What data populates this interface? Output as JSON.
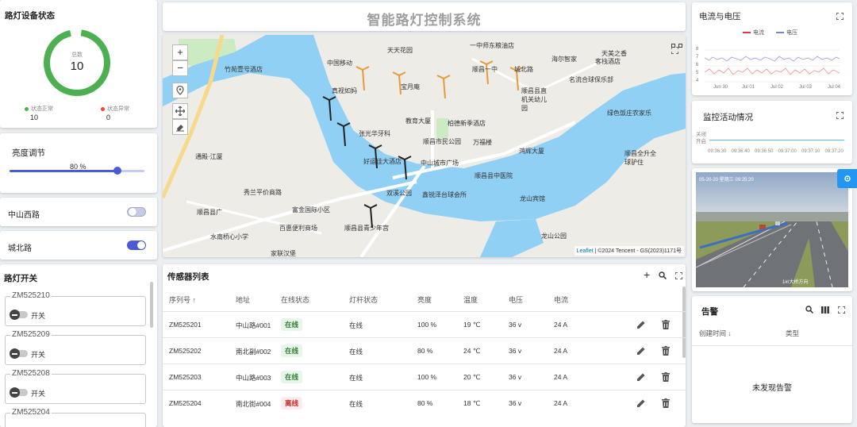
{
  "status": {
    "title": "路灯设备状态",
    "total_label": "总数",
    "total_value": "10",
    "normal_label": "状态正常",
    "normal_value": "10",
    "abnormal_label": "状态异常",
    "abnormal_value": "0",
    "normal_color": "#4caf50",
    "abnormal_color": "#f44336"
  },
  "brightness": {
    "title": "亮度调节",
    "value_label": "80 %",
    "value": 0.8
  },
  "roads": [
    {
      "name": "中山西路",
      "on": false
    },
    {
      "name": "城北路",
      "on": true
    }
  ],
  "switches": {
    "title": "路灯开关",
    "items": [
      {
        "id": "ZM525210",
        "label": "开关"
      },
      {
        "id": "ZM525209",
        "label": "开关"
      },
      {
        "id": "ZM525208",
        "label": "开关"
      },
      {
        "id": "ZM525204",
        "label": ""
      }
    ]
  },
  "header": {
    "title": "智能路灯控制系统"
  },
  "map": {
    "attribution_leaflet": "Leaflet",
    "attribution_rest": " | ©2024 Tencent - GS(2023)1171号",
    "labels": [
      "天天花园",
      "一中师东粮油店",
      "中国移动",
      "天美之香",
      "竹苑壹号酒店",
      "海尔智家",
      "客栈酒店",
      "宝月庵",
      "顺昌一中",
      "城北路",
      "名流合球保乐部",
      "真视如妈",
      "顺昌县直机关幼儿园",
      "绿色饭庄农家乐",
      "教育大厦",
      "柏德新季酒店",
      "张光华牙科",
      "顺昌市民公园",
      "万福楼",
      "鸿辉大厦",
      "顺昌全升全球驴住",
      "好运佳大酒店",
      "中山城市广场",
      "顺昌县中医院",
      "通殿·江厦",
      "龙山宾馆",
      "秀兰平价商路",
      "双溪公园",
      "鑫锐泽台球会所",
      "顺昌县广",
      "富金国际小区",
      "百惠便利商场",
      "顺昌县青少年宫",
      "水南桥心小学",
      "龙山公园",
      "家联汉堡"
    ]
  },
  "chart": {
    "title": "电流与电压",
    "legend_current": "电流",
    "legend_voltage": "电压",
    "current_color": "#e53935",
    "voltage_color": "#7986cb",
    "y_ticks": [
      "8",
      "7",
      "6",
      "5",
      "4"
    ],
    "x_ticks": [
      "Jun 30",
      "Jul 01",
      "Jul 02",
      "Jul 03",
      "Jul 04"
    ]
  },
  "monitor": {
    "title": "监控活动情况",
    "y_off": "关闭",
    "y_on": "开启",
    "x_ticks": [
      "09:36:30",
      "09:36:40",
      "09:36:50",
      "09:37:00",
      "09:37:10",
      "09:37:20"
    ]
  },
  "camera": {
    "timestamp": "05-20-20  星期三  09:25:20",
    "caption": "1#/大桥方向"
  },
  "sensors": {
    "title": "传感器列表",
    "columns": [
      "序列号 ↑",
      "地址",
      "在线状态",
      "灯杆状态",
      "亮度",
      "温度",
      "电压",
      "电流"
    ],
    "rows": [
      {
        "serial": "ZM525201",
        "address": "中山路#001",
        "online": "在线",
        "pole": "在线",
        "brightness": "100 %",
        "temp": "19 ℃",
        "voltage": "36 v",
        "current": "24 A"
      },
      {
        "serial": "ZM525202",
        "address": "南北副#002",
        "online": "在线",
        "pole": "在线",
        "brightness": "80 %",
        "temp": "24 ℃",
        "voltage": "36 v",
        "current": "24 A"
      },
      {
        "serial": "ZM525203",
        "address": "中山路#003",
        "online": "在线",
        "pole": "在线",
        "brightness": "100 %",
        "temp": "20 ℃",
        "voltage": "36 v",
        "current": "24 A"
      },
      {
        "serial": "ZM525204",
        "address": "南北街#004",
        "online": "离线",
        "pole": "在线",
        "brightness": "80 %",
        "temp": "18 ℃",
        "voltage": "36 v",
        "current": "24 A"
      }
    ],
    "online_color": "#2e7d32",
    "online_bg": "#e8f5e9",
    "offline_color": "#c62828",
    "offline_bg": "#ffebee"
  },
  "alarm": {
    "title": "告警",
    "col_time": "创建时间 ↓",
    "col_type": "类型",
    "empty": "未发现告警"
  }
}
